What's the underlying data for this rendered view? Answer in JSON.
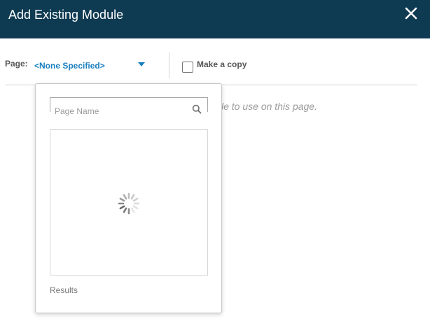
{
  "dialog": {
    "title": "Add Existing Module",
    "close_icon": "close-icon"
  },
  "toolbar": {
    "page_label": "Page:",
    "page_select_value": "<None Specified>",
    "make_copy_label": "Make a copy",
    "make_copy_checked": false
  },
  "main": {
    "hint_text": "le to use on this page."
  },
  "page_dropdown": {
    "search_placeholder": "Page Name",
    "search_value": "",
    "search_icon": "search-icon",
    "loading_icon": "spinner-icon",
    "results_label": "Results"
  },
  "colors": {
    "header_bg": "#0e3a52",
    "accent": "#1b7fbf"
  }
}
